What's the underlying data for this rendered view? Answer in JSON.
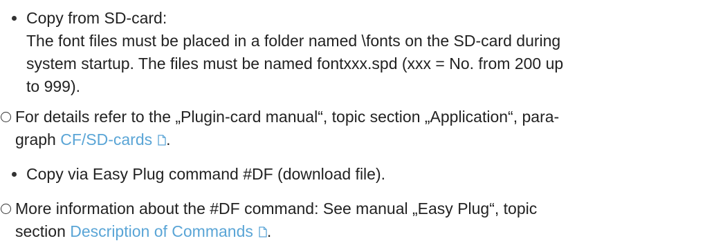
{
  "items": [
    {
      "type": "bullet",
      "title": "Copy from SD-card:",
      "line1": "The font files must be placed in a folder named \\fonts on the SD-card during",
      "line2": "system startup. The files must be named fontxxx.spd (xxx = No. from 200 up",
      "line3": "to 999)."
    },
    {
      "type": "note",
      "line1": "For details refer to the „Plugin-card manual“, topic section „Application“, para-",
      "line2_prefix": "graph ",
      "link": "CF/SD-cards"
    },
    {
      "type": "bullet",
      "line1": "Copy via Easy Plug command #DF (download file)."
    },
    {
      "type": "note",
      "line1": "More information about the #DF command: See manual „Easy Plug“, topic",
      "line2_prefix": "section ",
      "link": "Description of Commands",
      "line2_suffix": "."
    }
  ],
  "colors": {
    "text": "#222222",
    "link": "#5aa5d6"
  },
  "icons": {
    "bullet": "filled-dot-icon",
    "note": "open-circle-icon",
    "link_marker": "document-icon"
  }
}
